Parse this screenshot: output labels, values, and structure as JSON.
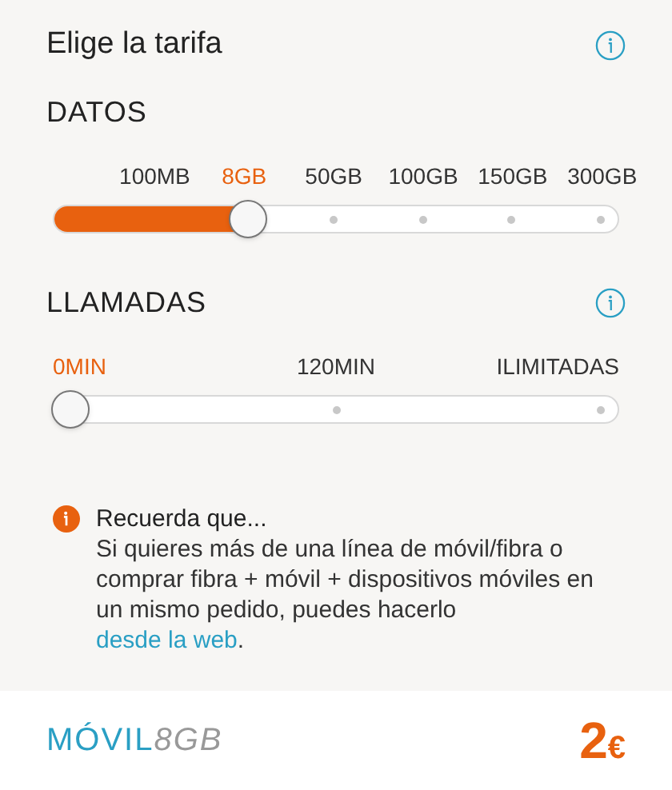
{
  "title": "Elige la tarifa",
  "sections": [
    {
      "heading": "DATOS",
      "info": false,
      "level": 0.345,
      "stops": [
        {
          "label": "100MB",
          "selected": false
        },
        {
          "label": "8GB",
          "selected": true
        },
        {
          "label": "50GB",
          "selected": false
        },
        {
          "label": "100GB",
          "selected": false
        },
        {
          "label": "150GB",
          "selected": false
        },
        {
          "label": "300GB",
          "selected": false
        }
      ]
    },
    {
      "heading": "LLAMADAS",
      "info": true,
      "level": 0,
      "stops": [
        {
          "label": "0MIN",
          "selected": true
        },
        {
          "label": "120MIN",
          "selected": false
        },
        {
          "label": "ILIMITADAS",
          "selected": false
        }
      ]
    }
  ],
  "notice": {
    "title": "Recuerda que...",
    "text": "Si quieres más de una línea de móvil/fibra o comprar fibra + móvil + dispositivos móviles en un mismo pedido, puedes hacerlo ",
    "link": "desde la web",
    "after": "."
  },
  "footer": {
    "product": "MÓVIL",
    "plan": "8GB",
    "price": "2",
    "currency": "€"
  }
}
